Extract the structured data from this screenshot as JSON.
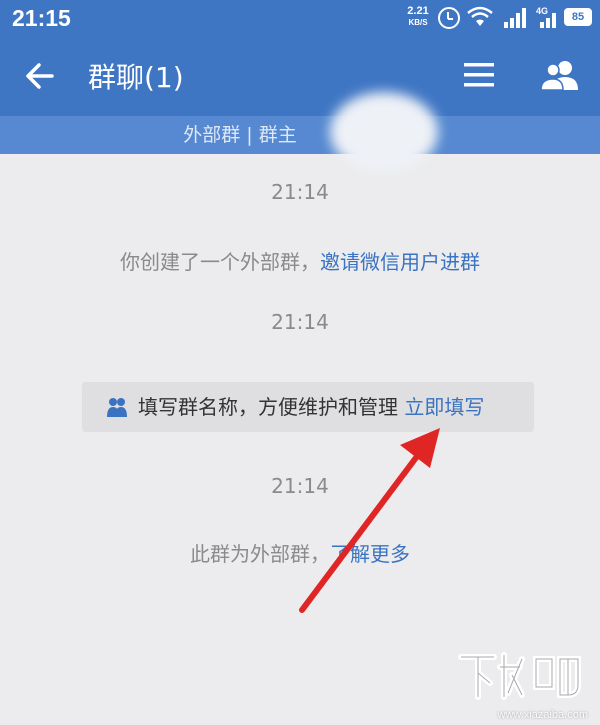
{
  "status_bar": {
    "time": "21:15",
    "speed_value": "2.21",
    "speed_unit": "KB/S",
    "network": "4G",
    "battery": "85"
  },
  "app_bar": {
    "title": "群聊(1)"
  },
  "sub_header": {
    "text": "外部群 | 群主"
  },
  "messages": [
    {
      "time": "21:14"
    },
    {
      "text": "你创建了一个外部群，",
      "link": "邀请微信用户进群"
    },
    {
      "time": "21:14"
    },
    {
      "text": "填写群名称，方便维护和管理",
      "link": "立即填写"
    },
    {
      "time": "21:14"
    },
    {
      "text": "此群为外部群，",
      "link": "了解更多"
    }
  ],
  "colors": {
    "header": "#3f76c4",
    "subheader": "#5689d1",
    "link": "#3a73c1",
    "annotation_arrow": "#e02525"
  },
  "watermark": {
    "logo": "下载吧",
    "url": "www.xiazaiba.com"
  }
}
